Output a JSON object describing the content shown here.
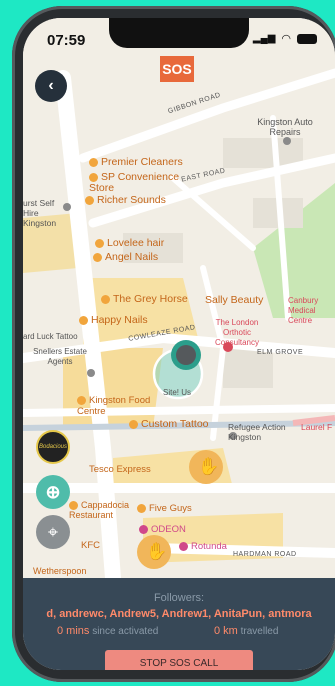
{
  "status": {
    "time": "07:59"
  },
  "sos_label": "SOS",
  "roads": [
    "GIBBON ROAD",
    "EAST ROAD",
    "COWLEAZE ROAD",
    "ELM GROVE",
    "HARDMAN ROAD"
  ],
  "places": [
    "Kingston Auto Repairs",
    "Premier Cleaners",
    "SP Convenience Store",
    "Richer Sounds",
    "Lovelee hair",
    "Angel Nails",
    "The Grey Horse",
    "Sally Beauty",
    "Canbury Medical Centre",
    "Happy Nails",
    "The London Orthotic Consultancy",
    "Snellers Estate Agents",
    "ard Luck Tattoo",
    "Kingston Food Centre",
    "Custom Tattoo",
    "Refugee Action Kingston",
    "Laurel F",
    "Tesco Express",
    "Cappadocia Restaurant",
    "Five Guys",
    "ODEON",
    "Rotunda",
    "KFC",
    "urst Self Hire Kingston",
    "Wetherspoon"
  ],
  "user_marker_label": "Site! Us",
  "logo_text": "Bodacious",
  "panel": {
    "followers_title": "Followers:",
    "followers_names": "d, andrewc, Andrew5, Andrew1, AnitaPun, antmora",
    "mins_value": "0 mins",
    "mins_label": "since activated",
    "km_value": "0 km",
    "km_label": "travelled",
    "stop_button": "STOP SOS CALL"
  },
  "colors": {
    "accent": "#e8693b",
    "panel": "#374857",
    "stop": "#ee8a80",
    "bg": "#1ee8c4"
  }
}
